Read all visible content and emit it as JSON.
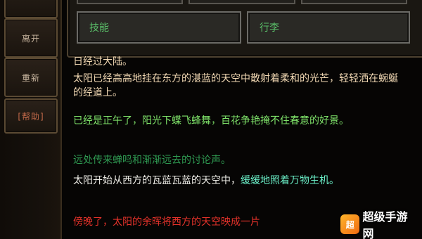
{
  "side_menu": {
    "items": [
      {
        "label": ""
      },
      {
        "label": "离开"
      },
      {
        "label": "重新"
      },
      {
        "label": "[帮助]"
      }
    ]
  },
  "top_panel": {
    "slots": [
      {
        "label": "技能"
      },
      {
        "label": "行李"
      }
    ]
  },
  "story": {
    "header": "日经过大陆。",
    "paragraphs": [
      {
        "text": "太阳已经高高地挂在东方的湛蓝的天空中散射着柔和的光芒，轻轻洒在蜿蜒的经道上。",
        "color": "cream"
      },
      {
        "text": "已经是正午了，阳光下蝶飞蜂舞，百花争艳掩不住春意的好景。",
        "color": "green"
      },
      {
        "text": "远处传来蝉鸣和渐渐远去的讨论声。",
        "color": "dim"
      },
      {
        "text_a": "太阳开始从西方的瓦蓝瓦蓝的天空中，",
        "text_b": "缓缓地照着万物生机。",
        "color": "white"
      },
      {
        "text": "傍晚了，太阳的余晖将西方的天空映成一片",
        "color": "red"
      }
    ]
  },
  "watermark": {
    "text": "超级手游网",
    "logo_char": "超"
  }
}
